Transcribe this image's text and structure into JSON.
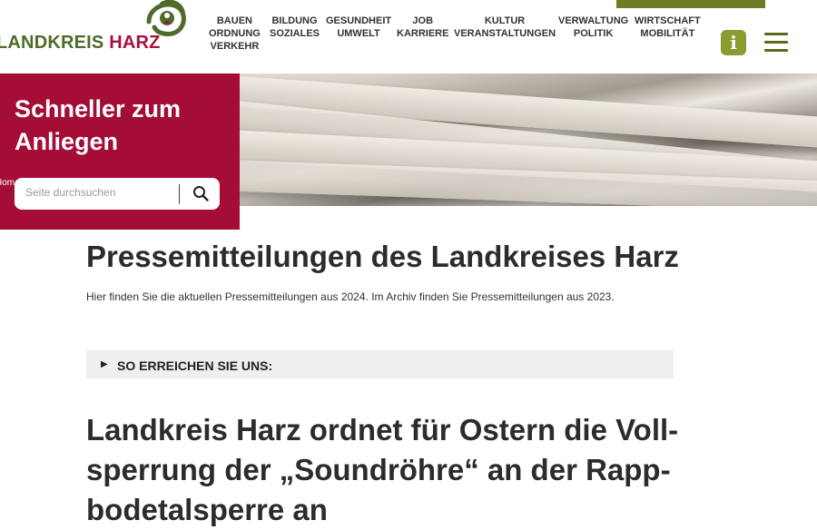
{
  "header": {
    "logo": {
      "part1": "LANDKREIS",
      "part2": "HARZ"
    },
    "nav": [
      {
        "lines": [
          "BAUEN",
          "ORDNUNG",
          "VERKEHR"
        ]
      },
      {
        "lines": [
          "BILDUNG",
          "SOZIALES"
        ]
      },
      {
        "lines": [
          "GESUNDHEIT",
          "UMWELT"
        ]
      },
      {
        "lines": [
          "JOB",
          "KARRIERE"
        ]
      },
      {
        "lines": [
          "KULTUR",
          "VERANSTALTUNGEN"
        ]
      },
      {
        "lines": [
          "VERWALTUNG",
          "POLITIK"
        ]
      },
      {
        "lines": [
          "WIRTSCHAFT",
          "MOBILITÄT"
        ]
      }
    ],
    "info_icon": "info-icon",
    "menu_icon": "hamburger-menu-icon"
  },
  "search": {
    "title_line1": "Schneller zum",
    "title_line2": "Anliegen",
    "placeholder": "Seite durchsuchen",
    "breadcrumb_peek": "Hom"
  },
  "main": {
    "page_title": "Pressemitteilungen des Landkreises Harz",
    "intro": "Hier finden Sie die aktuellen Pressemitteilungen aus 2024. Im Archiv finden Sie Pressemitteilungen aus 2023.",
    "accordion_label": "SO ERREICHEN SIE UNS:",
    "article_title_lines": [
      "Landkreis Harz ordnet für Ostern die Voll-",
      "sperrung der „Soundröhre“ an der Rapp-",
      "bodetalsperre an"
    ]
  },
  "colors": {
    "brand_red": "#a30d36",
    "brand_green": "#4f6b2a",
    "accent_olive": "#8a9b2f"
  }
}
